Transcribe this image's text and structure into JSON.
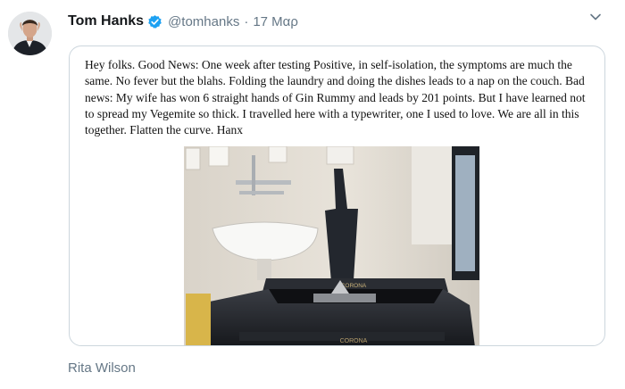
{
  "tweet": {
    "author_name": "Tom Hanks",
    "handle": "@tomhanks",
    "separator": "·",
    "date": "17 Μαρ",
    "verified_icon": "verified-badge-icon",
    "more_icon": "chevron-down-icon",
    "accent_color": "#1da1f2"
  },
  "card": {
    "text": "Hey folks. Good News: One week after testing Positive, in self-isolation, the symptoms are much the same. No fever but the blahs. Folding the laundry and doing the dishes leads to a nap on the couch. Bad news: My wife has won 6 straight hands of Gin Rummy and leads by 201 points. But I have learned not to spread my Vegemite so thick. I travelled here with a typewriter, one I used to love. We are all in this together. Flatten the curve. Hanx",
    "typewriter_brand": "CORONA",
    "typewriter_brand_front": "CORONA"
  },
  "reply_context": "Rita Wilson"
}
